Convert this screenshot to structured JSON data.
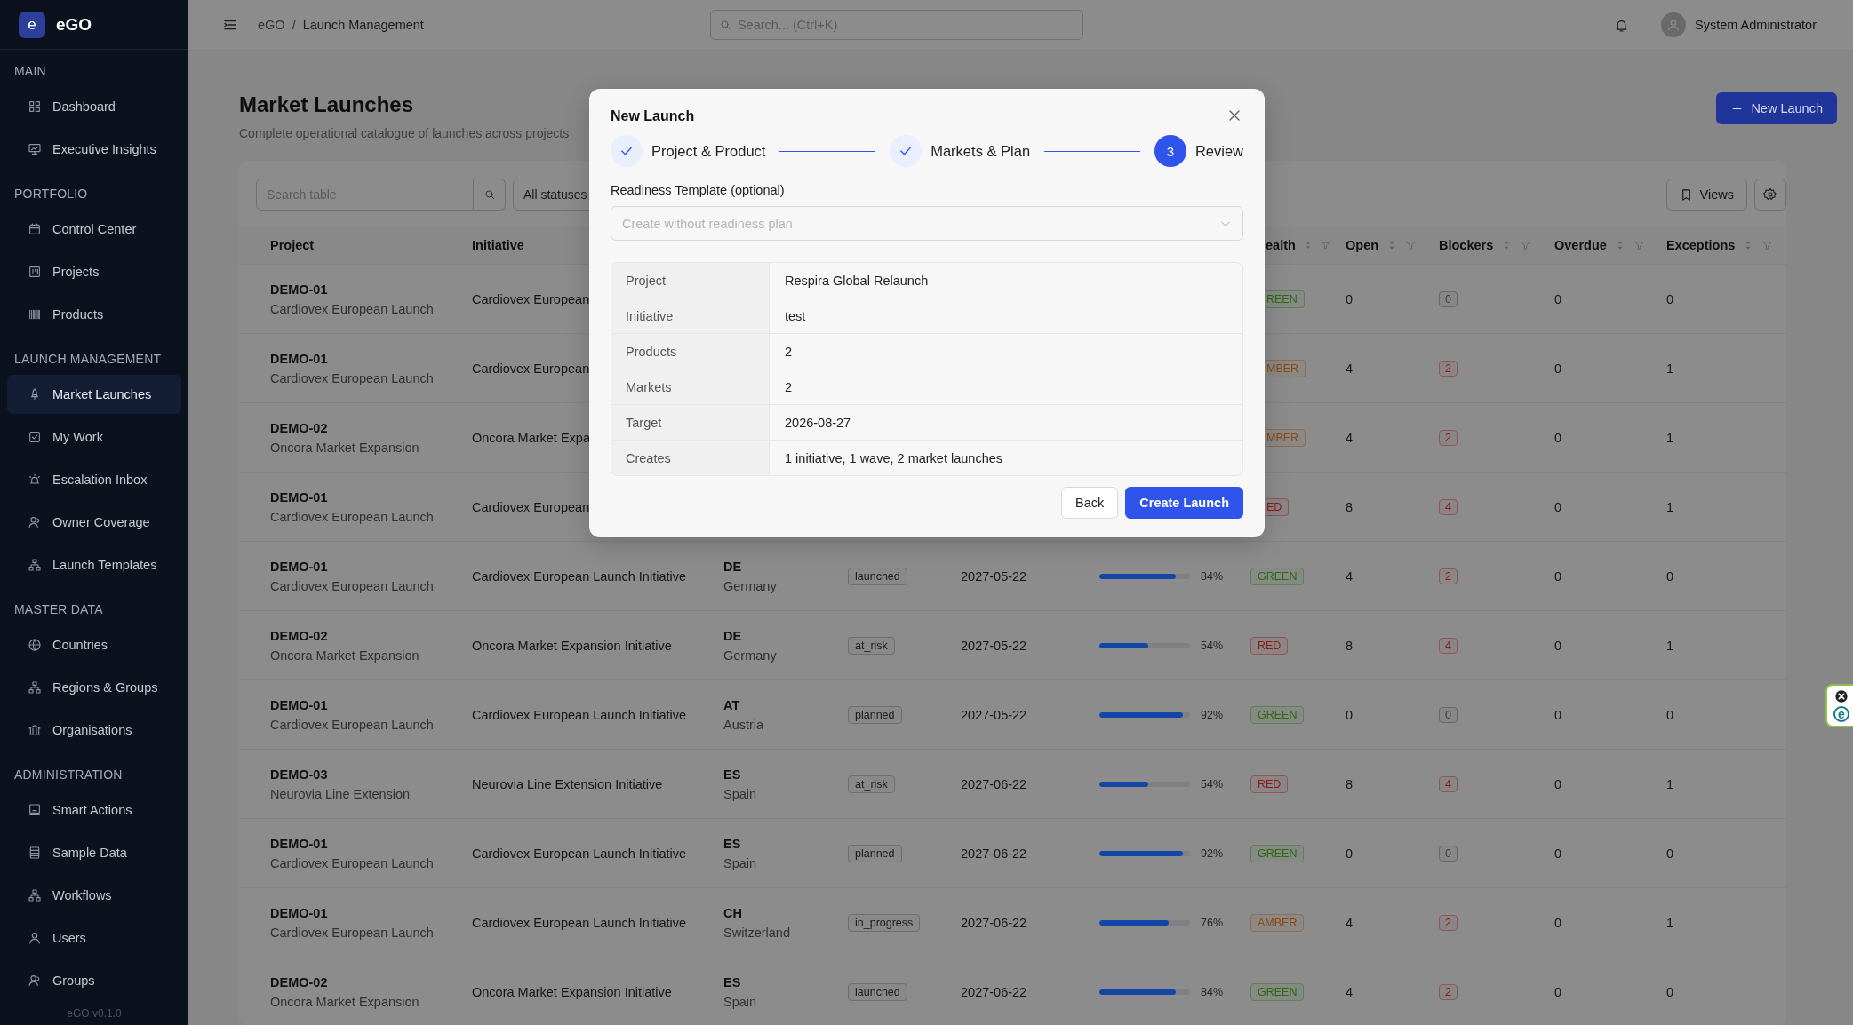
{
  "sidebar": {
    "logo": {
      "mark": "e",
      "name": "eGO"
    },
    "sections": [
      {
        "title": "MAIN",
        "items": [
          {
            "label": "Dashboard",
            "selected": false
          },
          {
            "label": "Executive Insights",
            "selected": false
          }
        ]
      },
      {
        "title": "PORTFOLIO",
        "items": [
          {
            "label": "Control Center",
            "selected": false
          },
          {
            "label": "Projects",
            "selected": false
          },
          {
            "label": "Products",
            "selected": false
          }
        ]
      },
      {
        "title": "LAUNCH MANAGEMENT",
        "items": [
          {
            "label": "Market Launches",
            "selected": true
          },
          {
            "label": "My Work",
            "selected": false
          },
          {
            "label": "Escalation Inbox",
            "selected": false
          },
          {
            "label": "Owner Coverage",
            "selected": false
          },
          {
            "label": "Launch Templates",
            "selected": false
          }
        ]
      },
      {
        "title": "MASTER DATA",
        "items": [
          {
            "label": "Countries",
            "selected": false
          },
          {
            "label": "Regions & Groups",
            "selected": false
          },
          {
            "label": "Organisations",
            "selected": false
          }
        ]
      },
      {
        "title": "ADMINISTRATION",
        "items": [
          {
            "label": "Smart Actions",
            "selected": false
          },
          {
            "label": "Sample Data",
            "selected": false
          },
          {
            "label": "Workflows",
            "selected": false
          },
          {
            "label": "Users",
            "selected": false
          },
          {
            "label": "Groups",
            "selected": false
          }
        ]
      }
    ],
    "footer": "eGO v0.1.0"
  },
  "header": {
    "breadcrumb": [
      "eGO",
      "Launch Management"
    ],
    "separator": "/",
    "search": {
      "placeholder": "Search... (Ctrl+K)"
    },
    "user": "System Administrator"
  },
  "page": {
    "title": "Market Launches",
    "subtitle": "Complete operational catalogue of launches across projects",
    "new_button": "New Launch"
  },
  "table_toolbar": {
    "search": {
      "placeholder": "Search table"
    },
    "status_filter": "All statuses",
    "views_button": "Views"
  },
  "table": {
    "columns": [
      {
        "label": "Project",
        "kind": "plain"
      },
      {
        "label": "Initiative",
        "kind": "plain"
      },
      {
        "label": "ealth",
        "kind": "clipped"
      },
      {
        "label": "Open",
        "kind": "sortable"
      },
      {
        "label": "Blockers",
        "kind": "sortable"
      },
      {
        "label": "Overdue",
        "kind": "sortable"
      },
      {
        "label": "Exceptions",
        "kind": "sortable"
      }
    ],
    "rows": [
      {
        "project_code": "DEMO-01",
        "project_name": "Cardiovex European Launch",
        "initiative": "Cardiovex European",
        "health": {
          "label": "REEN",
          "color": "#2e6a10",
          "clipped": true
        },
        "open": "0",
        "blockers": {
          "label": "0",
          "color": "#3a3a3a"
        },
        "overdue": "0",
        "exceptions": "0"
      },
      {
        "project_code": "DEMO-01",
        "project_name": "Cardiovex European Launch",
        "initiative": "Cardiovex European",
        "health": {
          "label": "MBER",
          "color": "#8a4a10",
          "clipped": true
        },
        "open": "4",
        "blockers": {
          "label": "2",
          "color": "#8a1a1a"
        },
        "overdue": "0",
        "exceptions": "1"
      },
      {
        "project_code": "DEMO-02",
        "project_name": "Oncora Market Expansion",
        "initiative": "Oncora Market Expa",
        "health": {
          "label": "MBER",
          "color": "#8a4a10",
          "clipped": true
        },
        "open": "4",
        "blockers": {
          "label": "2",
          "color": "#8a1a1a"
        },
        "overdue": "0",
        "exceptions": "1"
      },
      {
        "project_code": "DEMO-01",
        "project_name": "Cardiovex European Launch",
        "initiative": "Cardiovex European",
        "health": {
          "label": "ED",
          "color": "#8a1a1a",
          "clipped": true
        },
        "open": "8",
        "blockers": {
          "label": "4",
          "color": "#8a1a1a"
        },
        "overdue": "0",
        "exceptions": "1"
      },
      {
        "project_code": "DEMO-01",
        "project_name": "Cardiovex European Launch",
        "initiative": "Cardiovex European Launch Initiative",
        "market_code": "DE",
        "market_name": "Germany",
        "status": "launched",
        "target": "2027-05-22",
        "progress": {
          "level": 0.84,
          "reading": "84%"
        },
        "health": {
          "label": "GREEN",
          "color": "#2e6a10",
          "clipped": false
        },
        "open": "4",
        "blockers": {
          "label": "2",
          "color": "#8a1a1a"
        },
        "overdue": "0",
        "exceptions": "0"
      },
      {
        "project_code": "DEMO-02",
        "project_name": "Oncora Market Expansion",
        "initiative": "Oncora Market Expansion Initiative",
        "market_code": "DE",
        "market_name": "Germany",
        "status": "at_risk",
        "target": "2027-05-22",
        "progress": {
          "level": 0.54,
          "reading": "54%"
        },
        "health": {
          "label": "RED",
          "color": "#8a1a1a",
          "clipped": false
        },
        "open": "8",
        "blockers": {
          "label": "4",
          "color": "#8a1a1a"
        },
        "overdue": "0",
        "exceptions": "1"
      },
      {
        "project_code": "DEMO-01",
        "project_name": "Cardiovex European Launch",
        "initiative": "Cardiovex European Launch Initiative",
        "market_code": "AT",
        "market_name": "Austria",
        "status": "planned",
        "target": "2027-05-22",
        "progress": {
          "level": 0.92,
          "reading": "92%"
        },
        "health": {
          "label": "GREEN",
          "color": "#2e6a10",
          "clipped": false
        },
        "open": "0",
        "blockers": {
          "label": "0",
          "color": "#3a3a3a"
        },
        "overdue": "0",
        "exceptions": "0"
      },
      {
        "project_code": "DEMO-03",
        "project_name": "Neurovia Line Extension",
        "initiative": "Neurovia Line Extension Initiative",
        "market_code": "ES",
        "market_name": "Spain",
        "status": "at_risk",
        "target": "2027-06-22",
        "progress": {
          "level": 0.54,
          "reading": "54%"
        },
        "health": {
          "label": "RED",
          "color": "#8a1a1a",
          "clipped": false
        },
        "open": "8",
        "blockers": {
          "label": "4",
          "color": "#8a1a1a"
        },
        "overdue": "0",
        "exceptions": "1"
      },
      {
        "project_code": "DEMO-01",
        "project_name": "Cardiovex European Launch",
        "initiative": "Cardiovex European Launch Initiative",
        "market_code": "ES",
        "market_name": "Spain",
        "status": "planned",
        "target": "2027-06-22",
        "progress": {
          "level": 0.92,
          "reading": "92%"
        },
        "health": {
          "label": "GREEN",
          "color": "#2e6a10",
          "clipped": false
        },
        "open": "0",
        "blockers": {
          "label": "0",
          "color": "#3a3a3a"
        },
        "overdue": "0",
        "exceptions": "0"
      },
      {
        "project_code": "DEMO-01",
        "project_name": "Cardiovex European Launch",
        "initiative": "Cardiovex European Launch Initiative",
        "market_code": "CH",
        "market_name": "Switzerland",
        "status": "in_progress",
        "target": "2027-06-22",
        "progress": {
          "level": 0.76,
          "reading": "76%"
        },
        "health": {
          "label": "AMBER",
          "color": "#8a4a10",
          "clipped": false
        },
        "open": "4",
        "blockers": {
          "label": "2",
          "color": "#8a1a1a"
        },
        "overdue": "0",
        "exceptions": "1"
      },
      {
        "project_code": "DEMO-02",
        "project_name": "Oncora Market Expansion",
        "initiative": "Oncora Market Expansion Initiative",
        "market_code": "ES",
        "market_name": "Spain",
        "status": "launched",
        "target": "2027-06-22",
        "progress": {
          "level": 0.84,
          "reading": "84%"
        },
        "health": {
          "label": "GREEN",
          "color": "#2e6a10",
          "clipped": false
        },
        "open": "4",
        "blockers": {
          "label": "2",
          "color": "#8a1a1a"
        },
        "overdue": "0",
        "exceptions": "0"
      }
    ]
  },
  "modal": {
    "title": "New Launch",
    "steps": [
      {
        "label": "Project & Product",
        "done": true
      },
      {
        "label": "Markets & Plan",
        "done": true
      },
      {
        "label": "Review",
        "number": "3",
        "done": false
      }
    ],
    "template_label": "Readiness Template (optional)",
    "template_select": {
      "placeholder": "Create without readiness plan"
    },
    "summary": [
      {
        "label": "Project",
        "value": "Respira Global Relaunch"
      },
      {
        "label": "Initiative",
        "value": "test"
      },
      {
        "label": "Products",
        "value": "2"
      },
      {
        "label": "Markets",
        "value": "2"
      },
      {
        "label": "Target",
        "value": "2026-08-27"
      },
      {
        "label": "Creates",
        "value": "1 initiative, 1 wave, 2 market launches"
      }
    ],
    "buttons": [
      {
        "label": "Back",
        "kind": "secondary"
      },
      {
        "label": "Create Launch",
        "kind": "primary"
      }
    ]
  },
  "extension_badge": {
    "label": "e"
  }
}
